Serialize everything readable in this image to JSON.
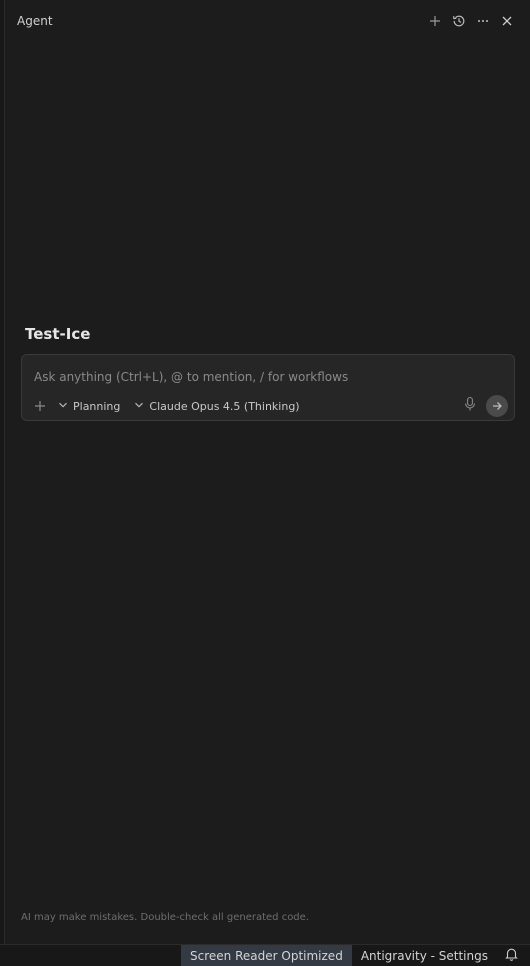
{
  "header": {
    "title": "Agent",
    "actions": [
      {
        "name": "new-chat",
        "icon": "plus-icon"
      },
      {
        "name": "history",
        "icon": "history-icon"
      },
      {
        "name": "more",
        "icon": "ellipsis-icon"
      },
      {
        "name": "close",
        "icon": "close-icon"
      }
    ]
  },
  "session": {
    "title": "Test-Ice"
  },
  "composer": {
    "placeholder": "Ask anything (Ctrl+L), @ to mention, / for workflows",
    "value": "",
    "mode_label": "Planning",
    "model_label": "Claude Opus 4.5 (Thinking)"
  },
  "disclaimer": "AI may make mistakes. Double-check all generated code.",
  "statusbar": {
    "screen_reader": "Screen Reader Optimized",
    "settings": "Antigravity - Settings",
    "bell_icon": "bell-icon"
  },
  "colors": {
    "background": "#1c1c1c",
    "composer_bg": "#262626",
    "status_highlight": "#333a44"
  }
}
